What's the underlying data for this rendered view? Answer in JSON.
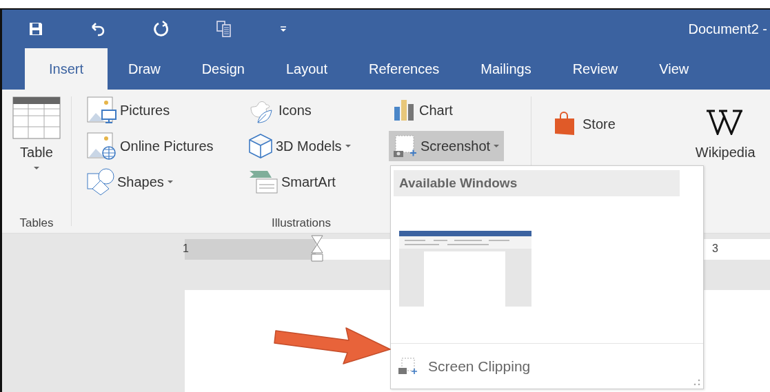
{
  "title_bar": {
    "title": "Document2 -"
  },
  "tabs": [
    {
      "label": "Insert",
      "selected": true
    },
    {
      "label": "Draw",
      "selected": false
    },
    {
      "label": "Design",
      "selected": false
    },
    {
      "label": "Layout",
      "selected": false
    },
    {
      "label": "References",
      "selected": false
    },
    {
      "label": "Mailings",
      "selected": false
    },
    {
      "label": "Review",
      "selected": false
    },
    {
      "label": "View",
      "selected": false
    }
  ],
  "ribbon": {
    "tables": {
      "label": "Tables",
      "button": {
        "label": "Table",
        "dropdown": true
      }
    },
    "illustrations": {
      "label": "Illustrations",
      "items": [
        {
          "label": "Pictures",
          "dropdown": false,
          "selected": false
        },
        {
          "label": "Online Pictures",
          "dropdown": false,
          "selected": false
        },
        {
          "label": "Shapes",
          "dropdown": true,
          "selected": false
        },
        {
          "label": "Icons",
          "dropdown": false,
          "selected": false
        },
        {
          "label": "3D Models",
          "dropdown": true,
          "selected": false
        },
        {
          "label": "SmartArt",
          "dropdown": false,
          "selected": false
        },
        {
          "label": "Chart",
          "dropdown": false,
          "selected": false
        },
        {
          "label": "Screenshot",
          "dropdown": true,
          "selected": true
        }
      ]
    },
    "addins": [
      {
        "label": "Store"
      },
      {
        "label": "Wikipedia"
      }
    ]
  },
  "ruler": {
    "labels": [
      "1",
      "3"
    ]
  },
  "screenshot_menu": {
    "header": "Available Windows",
    "windows": [
      {
        "kind": "window"
      }
    ],
    "footer": "Screen Clipping"
  }
}
